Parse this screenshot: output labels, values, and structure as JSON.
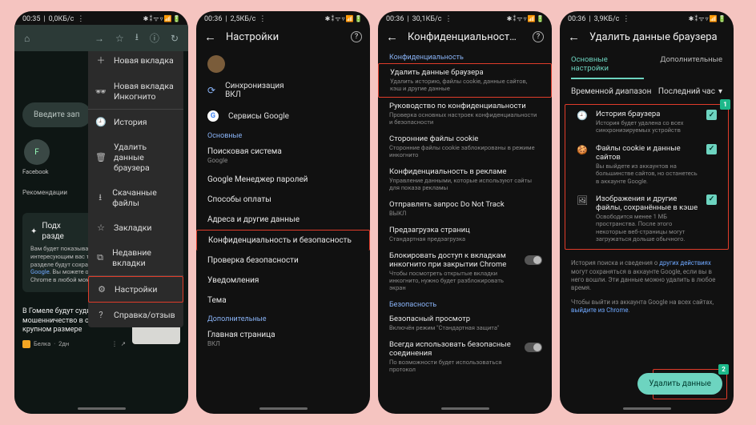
{
  "phone1": {
    "status": {
      "time": "00:35",
      "net": "0,0КБ/с",
      "icons": "⋮",
      "right": "⁂ ⁑ ᯤ ▦ 📶"
    },
    "toolbar": {
      "home": "⌂",
      "forward": "→",
      "star": "☆",
      "download": "⭳",
      "info": "ⓘ",
      "refresh": "↻"
    },
    "menu": [
      {
        "icon": "＋",
        "label": "Новая вкладка"
      },
      {
        "icon": "🕶",
        "label": "Новая вкладка Инкогнито"
      },
      {
        "icon": "🕘",
        "label": "История"
      },
      {
        "icon": "🗑",
        "label": "Удалить данные браузера"
      },
      {
        "icon": "⭳",
        "label": "Скачанные файлы"
      },
      {
        "icon": "☆",
        "label": "Закладки"
      },
      {
        "icon": "⧉",
        "label": "Недавние вкладки"
      },
      {
        "icon": "⚙",
        "label": "Настройки"
      },
      {
        "icon": "?",
        "label": "Справка/отзыв"
      }
    ],
    "search_placeholder": "Введите зап",
    "tile_label": "Facebook",
    "rec_label": "Рекомендации",
    "card": {
      "title": "Подх\nразде",
      "body": "Вам будет показываться больше статей по интересующим вас темам. Ваши действия в этом разделе будут сохраняться в вашем ",
      "link": "аккаунте Google",
      "body2": ". Вы можете отключить рекомендации в Chrome в любой момент."
    },
    "news": {
      "headline": "В Гомеле будут судить ИП за мошенничество в особо крупном размере",
      "source": "Белка",
      "age": "2дн"
    }
  },
  "phone2": {
    "status": {
      "time": "00:36",
      "net": "2,5КБ/с"
    },
    "title": "Настройки",
    "sync": {
      "label": "Синхронизация",
      "state": "ВКЛ"
    },
    "google_services": "Сервисы Google",
    "section_basic": "Основные",
    "items": [
      {
        "t": "Поисковая система",
        "s": "Google"
      },
      {
        "t": "Google Менеджер паролей"
      },
      {
        "t": "Способы оплаты"
      },
      {
        "t": "Адреса и другие данные"
      },
      {
        "t": "Конфиденциальность и безопасность"
      },
      {
        "t": "Проверка безопасности"
      },
      {
        "t": "Уведомления"
      },
      {
        "t": "Тема"
      }
    ],
    "section_more": "Дополнительные",
    "home": {
      "t": "Главная страница",
      "s": "ВКЛ"
    }
  },
  "phone3": {
    "status": {
      "time": "00:36",
      "net": "30,1КБ/с"
    },
    "title": "Конфиденциальность и безопас…",
    "section_priv": "Конфиденциальность",
    "items": [
      {
        "t": "Удалить данные браузера",
        "s": "Удалить историю, файлы cookie, данные сайтов, кэш и другие данные"
      },
      {
        "t": "Руководство по конфиденциальности",
        "s": "Проверка основных настроек конфиденциальности и безопасности"
      },
      {
        "t": "Сторонние файлы cookie",
        "s": "Сторонние файлы cookie заблокированы в режиме инкогнито"
      },
      {
        "t": "Конфиденциальность в рекламе",
        "s": "Управление данными, которые используют сайты для показа рекламы"
      },
      {
        "t": "Отправлять запрос Do Not Track",
        "s": "ВЫКЛ"
      },
      {
        "t": "Предзагрузка страниц",
        "s": "Стандартная предзагрузка"
      },
      {
        "t": "Блокировать доступ к вкладкам инкогнито при закрытии Chrome",
        "s": "Чтобы посмотреть открытые вкладки инкогнито, нужно будет разблокировать экран",
        "toggle": true
      }
    ],
    "section_sec": "Безопасность",
    "sec_items": [
      {
        "t": "Безопасный просмотр",
        "s": "Включён режим \"Стандартная защита\""
      },
      {
        "t": "Всегда использовать безопасные соединения",
        "s": "По возможности будет использоваться протокол",
        "toggle": true
      }
    ]
  },
  "phone4": {
    "status": {
      "time": "00:36",
      "net": "3,9КБ/с"
    },
    "title": "Удалить данные браузера",
    "tab_basic": "Основные настройки",
    "tab_advanced": "Дополнительные",
    "range_label": "Временной диапазон",
    "range_value": "Последний час",
    "checks": [
      {
        "icon": "🕘",
        "t": "История браузера",
        "s": "История будет удалена со всех синхронизируемых устройств"
      },
      {
        "icon": "🍪",
        "t": "Файлы cookie и данные сайтов",
        "s": "Вы выйдете из аккаунтов на большинстве сайтов, но останетесь в аккаунте Google."
      },
      {
        "icon": "🖼",
        "t": "Изображения и другие файлы, сохранённые в кэше",
        "s": "Освободится менее 1 МБ пространства. После этого некоторые веб-страницы могут загружаться дольше обычного."
      }
    ],
    "note1a": "История поиска и сведения о других действиях могут сохраняться в аккаунте Google, если вы в него вошли. Эти данные можно удалить в любое время.",
    "note1_link": "других действиях",
    "note2a": "Чтобы выйти из аккаунта Google на всех сайтах, ",
    "note2_link": "выйдите из Chrome",
    "button": "Удалить данные",
    "badge1": "1",
    "badge2": "2"
  }
}
